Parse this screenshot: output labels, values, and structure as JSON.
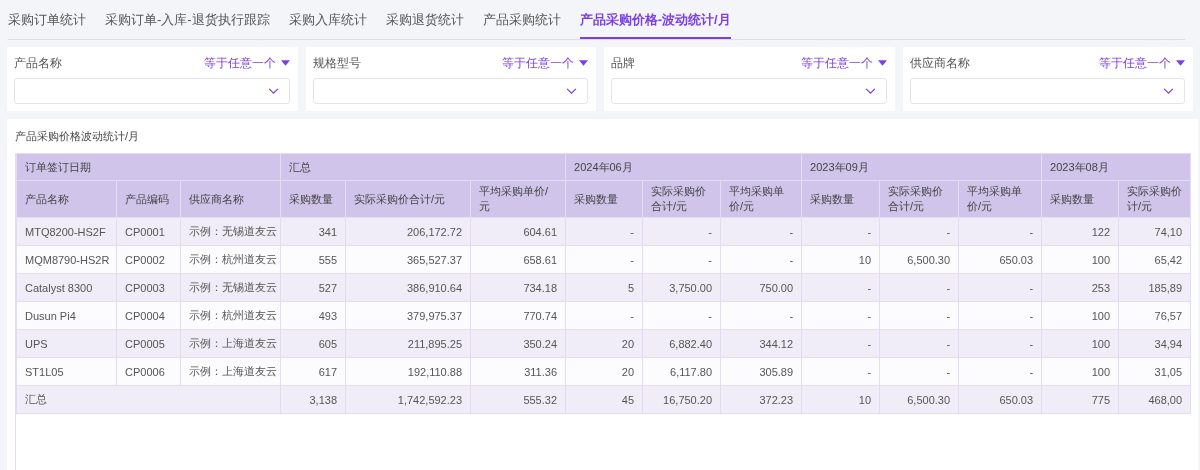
{
  "tabs": [
    {
      "label": "采购订单统计",
      "selected": false
    },
    {
      "label": "采购订单-入库-退货执行跟踪",
      "selected": false
    },
    {
      "label": "采购入库统计",
      "selected": false
    },
    {
      "label": "采购退货统计",
      "selected": false
    },
    {
      "label": "产品采购统计",
      "selected": false
    },
    {
      "label": "产品采购价格-波动统计/月",
      "selected": true
    }
  ],
  "filters": [
    {
      "label": "产品名称",
      "operator": "等于任意一个"
    },
    {
      "label": "规格型号",
      "operator": "等于任意一个"
    },
    {
      "label": "品牌",
      "operator": "等于任意一个"
    },
    {
      "label": "供应商名称",
      "operator": "等于任意一个"
    }
  ],
  "report": {
    "title": "产品采购价格波动统计/月",
    "table": {
      "header_groups": [
        {
          "label": "订单签订日期",
          "columns": [
            "产品名称",
            "产品编码",
            "供应商名称"
          ]
        },
        {
          "label": "汇总",
          "columns": [
            "采购数量",
            "实际采购价合计/元",
            "平均采购单价/元"
          ]
        },
        {
          "label": "2024年06月",
          "columns": [
            "采购数量",
            "实际采购价合计/元",
            "平均采购单价/元"
          ]
        },
        {
          "label": "2023年09月",
          "columns": [
            "采购数量",
            "实际采购价合计/元",
            "平均采购单价/元"
          ]
        },
        {
          "label": "2023年08月",
          "columns": [
            "采购数量",
            "实际采购价计/元"
          ]
        }
      ],
      "rows": [
        {
          "cells": [
            "MTQ8200-HS2F",
            "CP0001",
            "示例：无锡道友云",
            "341",
            "206,172.72",
            "604.61",
            "-",
            "-",
            "-",
            "-",
            "-",
            "-",
            "122",
            "74,10"
          ]
        },
        {
          "cells": [
            "MQM8790-HS2R",
            "CP0002",
            "示例：杭州道友云",
            "555",
            "365,527.37",
            "658.61",
            "-",
            "-",
            "-",
            "10",
            "6,500.30",
            "650.03",
            "100",
            "65,42"
          ]
        },
        {
          "cells": [
            "Catalyst 8300",
            "CP0003",
            "示例：无锡道友云",
            "527",
            "386,910.64",
            "734.18",
            "5",
            "3,750.00",
            "750.00",
            "-",
            "-",
            "-",
            "253",
            "185,89"
          ]
        },
        {
          "cells": [
            "Dusun Pi4",
            "CP0004",
            "示例：杭州道友云",
            "493",
            "379,975.37",
            "770.74",
            "-",
            "-",
            "-",
            "-",
            "-",
            "-",
            "100",
            "76,57"
          ]
        },
        {
          "cells": [
            "UPS",
            "CP0005",
            "示例：上海道友云",
            "605",
            "211,895.25",
            "350.24",
            "20",
            "6,882.40",
            "344.12",
            "-",
            "-",
            "-",
            "100",
            "34,94"
          ]
        },
        {
          "cells": [
            "ST1L05",
            "CP0006",
            "示例：上海道友云",
            "617",
            "192,110.88",
            "311.36",
            "20",
            "6,117.80",
            "305.89",
            "-",
            "-",
            "-",
            "100",
            "31,05"
          ]
        }
      ],
      "total": {
        "label": "汇总",
        "cells": [
          "3,138",
          "1,742,592.23",
          "555.32",
          "45",
          "16,750.20",
          "372.23",
          "10",
          "6,500.30",
          "650.03",
          "775",
          "468,00"
        ]
      }
    }
  }
}
